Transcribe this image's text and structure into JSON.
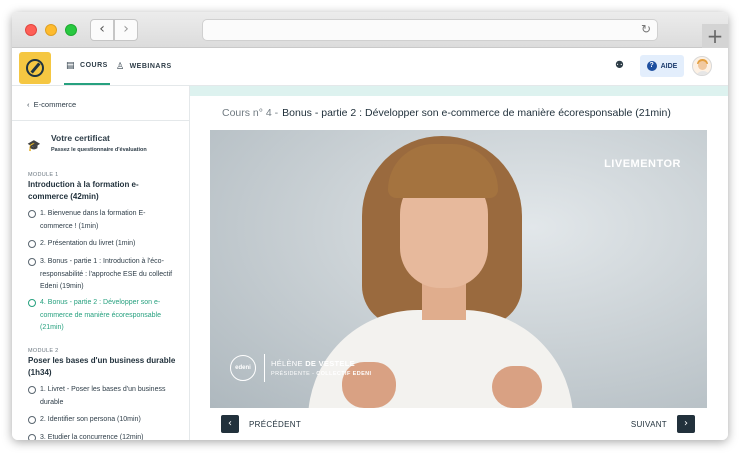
{
  "browser": {
    "back_glyph": "‹",
    "forward_glyph": "›",
    "reload_glyph": "↻",
    "new_tab_glyph": "+"
  },
  "header": {
    "tabs": [
      {
        "label": "COURS",
        "icon": "book-icon",
        "active": true
      },
      {
        "label": "WEBINARS",
        "icon": "person-icon",
        "active": false
      }
    ],
    "aide_label": "AIDE"
  },
  "sidebar": {
    "back_label": "E-commerce",
    "certificate": {
      "title": "Votre certificat",
      "subtitle": "Passez le questionnaire d'évaluation"
    },
    "modules": [
      {
        "label": "MODULE 1",
        "title": "Introduction à la formation e-commerce (42min)",
        "lessons": [
          {
            "text": "1. Bienvenue dans la formation E-commerce ! (1min)",
            "active": false
          },
          {
            "text": "2. Présentation du livret (1min)",
            "active": false
          },
          {
            "text": "3. Bonus - partie 1 : Introduction à l'éco-responsabilité : l'approche ESE du collectif Edeni (19min)",
            "active": false
          },
          {
            "text": "4. Bonus - partie 2 : Développer son e-commerce de manière écoresponsable (21min)",
            "active": true
          }
        ]
      },
      {
        "label": "MODULE 2",
        "title": "Poser les bases d'un business durable (1h34)",
        "lessons": [
          {
            "text": "1. Livret - Poser les bases d'un business durable",
            "active": false
          },
          {
            "text": "2. Identifier son persona (10min)",
            "active": false
          },
          {
            "text": "3. Etudier la concurrence (12min)",
            "active": false
          }
        ]
      }
    ]
  },
  "main": {
    "course_number": "Cours n° 4 -",
    "course_title": "Bonus - partie 2 : Développer son e-commerce de manière écoresponsable (21min)",
    "video": {
      "brand": "LIVEMENTOR",
      "seal_text": "edeni",
      "speaker_first": "HÉLÈNE",
      "speaker_last": "DE VESTELE",
      "role_prefix": "PRÉSIDENTE -",
      "role_org": "COLLECTIF EDENI"
    },
    "prev_label": "PRÉCÉDENT",
    "next_label": "SUIVANT",
    "prev_glyph": "‹",
    "next_glyph": "›"
  }
}
